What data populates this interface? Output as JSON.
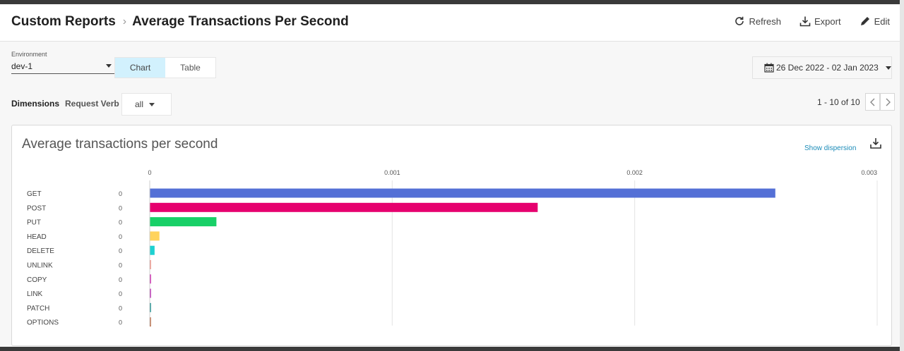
{
  "header": {
    "breadcrumb_root": "Custom Reports",
    "breadcrumb_sep": "›",
    "title": "Average Transactions Per Second",
    "actions": {
      "refresh": "Refresh",
      "export": "Export",
      "edit": "Edit"
    }
  },
  "controls": {
    "environment_label": "Environment",
    "environment_value": "dev-1",
    "view_tabs": [
      "Chart",
      "Table"
    ],
    "active_view": "Chart",
    "date_range": "26 Dec 2022 - 02 Jan 2023",
    "dimensions_label": "Dimensions",
    "request_verb_label": "Request Verb",
    "request_verb_value": "all",
    "pager": "1 - 10 of 10"
  },
  "card": {
    "title": "Average transactions per second",
    "show_dispersion": "Show dispersion"
  },
  "chart_data": {
    "type": "bar",
    "orientation": "horizontal",
    "categories": [
      "GET",
      "POST",
      "PUT",
      "HEAD",
      "DELETE",
      "UNLINK",
      "COPY",
      "LINK",
      "PATCH",
      "OPTIONS"
    ],
    "values": [
      0.00258,
      0.0016,
      0.000275,
      4e-05,
      2e-05,
      5e-06,
      5e-06,
      5e-06,
      5e-06,
      5e-06
    ],
    "value_labels": [
      "0",
      "0",
      "0",
      "0",
      "0",
      "0",
      "0",
      "0",
      "0",
      "0"
    ],
    "colors": [
      "#5470d6",
      "#e6006e",
      "#18d067",
      "#ffd35c",
      "#1dd1d1",
      "#f08a7e",
      "#c913a8",
      "#b51cb0",
      "#0e8a8a",
      "#b5633c"
    ],
    "xlim": [
      0,
      0.003
    ],
    "x_ticks": [
      "0",
      "0.001",
      "0.002",
      "0.003"
    ],
    "x_tick_values": [
      0,
      0.001,
      0.002,
      0.003
    ],
    "grid": true
  }
}
